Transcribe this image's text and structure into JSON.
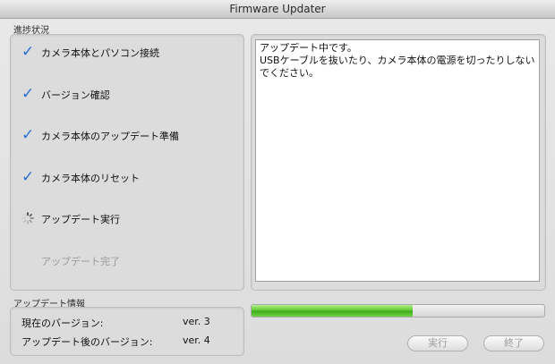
{
  "window": {
    "title": "Firmware Updater"
  },
  "progress_group": {
    "label": "進捗状況",
    "steps": [
      {
        "label": "カメラ本体とパソコン接続",
        "state": "done",
        "icon": "checkmark-icon"
      },
      {
        "label": "バージョン確認",
        "state": "done",
        "icon": "checkmark-icon"
      },
      {
        "label": "カメラ本体のアップデート準備",
        "state": "done",
        "icon": "checkmark-icon"
      },
      {
        "label": "カメラ本体のリセット",
        "state": "done",
        "icon": "checkmark-icon"
      },
      {
        "label": "アップデート実行",
        "state": "in-progress",
        "icon": "spinner-icon"
      },
      {
        "label": "アップデート完了",
        "state": "pending",
        "icon": ""
      }
    ]
  },
  "message": {
    "line1": "アップデート中です。",
    "line2": "USBケーブルを抜いたり、カメラ本体の電源を切ったりしないでください。"
  },
  "update_info": {
    "label": "アップデート情報",
    "current_label": "現在のバージョン:",
    "current_value": "ver. 3",
    "after_label": "アップデート後のバージョン:",
    "after_value": "ver. 4"
  },
  "progress_bar": {
    "percent": 55,
    "color": "#53c52a"
  },
  "buttons": {
    "run": "実行",
    "finish": "終了"
  },
  "colors": {
    "check": "#2a6fd6"
  }
}
